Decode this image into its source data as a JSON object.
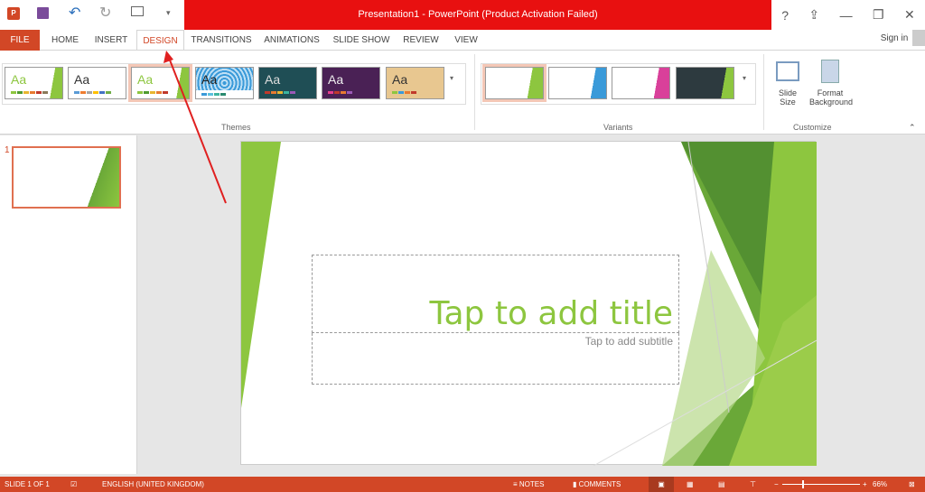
{
  "window": {
    "title": "Presentation1 - PowerPoint (Product Activation Failed)",
    "help": "?",
    "ribbon_display": "⇪",
    "minimize": "—",
    "restore": "❐",
    "close": "✕"
  },
  "qat": {
    "app_icon": "powerpoint-icon",
    "save": "save-icon",
    "undo": "undo-icon",
    "redo": "redo-icon",
    "present": "start-slideshow-icon",
    "customize": "▾"
  },
  "tabs": [
    {
      "label": "FILE"
    },
    {
      "label": "HOME"
    },
    {
      "label": "INSERT"
    },
    {
      "label": "DESIGN",
      "active": true
    },
    {
      "label": "TRANSITIONS"
    },
    {
      "label": "ANIMATIONS"
    },
    {
      "label": "SLIDE SHOW"
    },
    {
      "label": "REVIEW"
    },
    {
      "label": "VIEW"
    }
  ],
  "account": {
    "sign_in": "Sign in"
  },
  "ribbon": {
    "themes": {
      "label": "Themes",
      "items": [
        {
          "aa": "Aa"
        },
        {
          "aa": "Aa"
        },
        {
          "aa": "Aa",
          "selected": true
        },
        {
          "aa": "Aa"
        },
        {
          "aa": "Aa"
        },
        {
          "aa": "Aa"
        },
        {
          "aa": "Aa"
        }
      ]
    },
    "variants": {
      "label": "Variants"
    },
    "customize": {
      "label": "Customize",
      "slide_size": "Slide Size",
      "format_background": "Format Background"
    }
  },
  "colors": {
    "accent": "#d24726",
    "title_bar": "#e81010",
    "theme_green": "#8dc63f"
  },
  "slides_panel": {
    "number": "1"
  },
  "slide": {
    "title_placeholder": "Tap to add title",
    "subtitle_placeholder": "Tap to add subtitle"
  },
  "status": {
    "slide_info": "SLIDE 1 OF 1",
    "language": "ENGLISH (UNITED KINGDOM)",
    "notes": "NOTES",
    "comments": "COMMENTS",
    "zoom": "66%",
    "zoom_level": 66
  }
}
